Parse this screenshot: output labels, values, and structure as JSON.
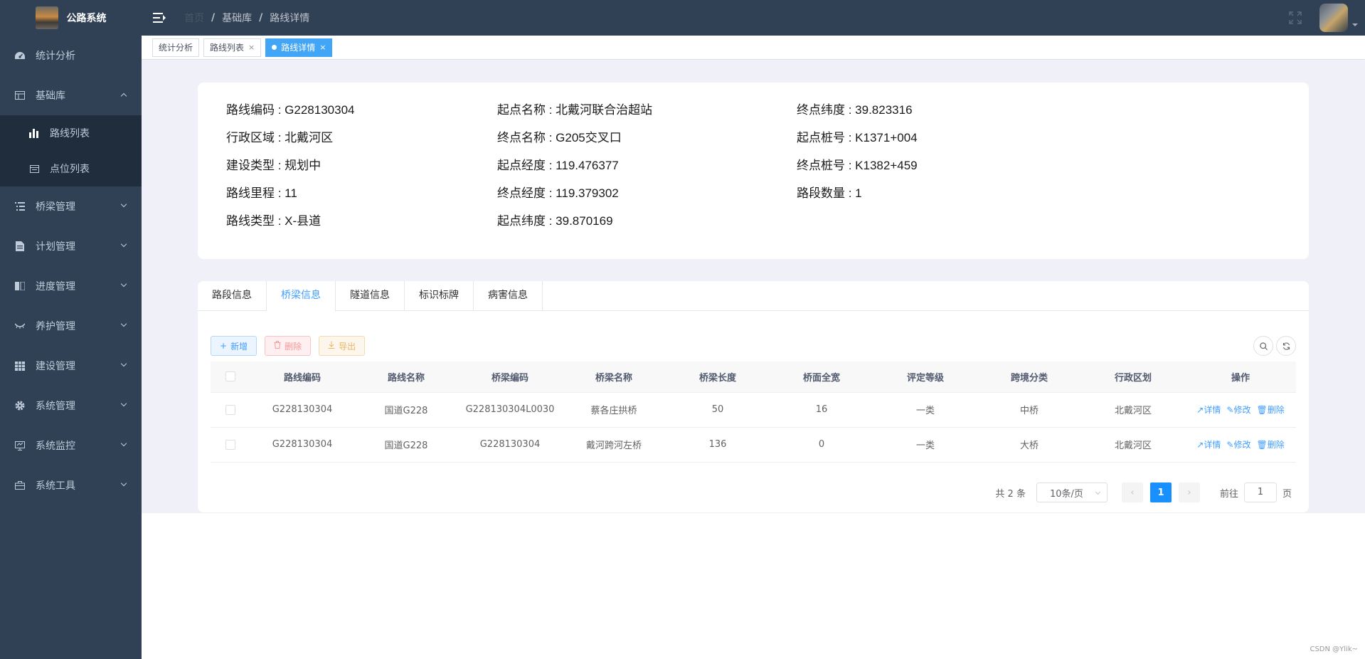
{
  "app": {
    "title": "公路系统"
  },
  "sidebar": {
    "items": [
      {
        "label": "统计分析",
        "icon": "dashboard-icon"
      },
      {
        "label": "基础库",
        "icon": "table-icon",
        "expanded": true,
        "children": [
          {
            "label": "路线列表",
            "icon": "chart-icon"
          },
          {
            "label": "点位列表",
            "icon": "calendar-icon"
          }
        ]
      },
      {
        "label": "桥梁管理",
        "icon": "list-icon"
      },
      {
        "label": "计划管理",
        "icon": "document-icon"
      },
      {
        "label": "进度管理",
        "icon": "book-icon"
      },
      {
        "label": "养护管理",
        "icon": "eye-icon"
      },
      {
        "label": "建设管理",
        "icon": "grid-icon"
      },
      {
        "label": "系统管理",
        "icon": "gear-icon"
      },
      {
        "label": "系统监控",
        "icon": "monitor-icon"
      },
      {
        "label": "系统工具",
        "icon": "toolbox-icon"
      }
    ]
  },
  "breadcrumb": {
    "home": "首页",
    "level1": "基础库",
    "level2": "路线详情"
  },
  "tags": [
    {
      "label": "统计分析"
    },
    {
      "label": "路线列表"
    },
    {
      "label": "路线详情",
      "active": true
    }
  ],
  "info": {
    "col1": [
      "路线编码 : G228130304",
      "行政区域 : 北戴河区",
      "建设类型 : 规划中",
      "路线里程 : 11",
      "路线类型 : X-县道"
    ],
    "col2": [
      "起点名称 : 北戴河联合治超站",
      "终点名称 : G205交叉口",
      "起点经度 : 119.476377",
      "终点经度 : 119.379302",
      "起点纬度 : 39.870169"
    ],
    "col3": [
      "终点纬度 : 39.823316",
      "起点桩号 : K1371+004",
      "终点桩号 : K1382+459",
      "路段数量 : 1"
    ]
  },
  "tabs": [
    "路段信息",
    "桥梁信息",
    "隧道信息",
    "标识标牌",
    "病害信息"
  ],
  "active_tab": "桥梁信息",
  "toolbar": {
    "add": "新增",
    "delete": "删除",
    "export": "导出"
  },
  "table": {
    "headers": [
      "路线编码",
      "路线名称",
      "桥梁编码",
      "桥梁名称",
      "桥梁长度",
      "桥面全宽",
      "评定等级",
      "跨境分类",
      "行政区划",
      "操作"
    ],
    "rows": [
      [
        "G228130304",
        "国道G228",
        "G228130304L0030",
        "蔡各庄拱桥",
        "50",
        "16",
        "一类",
        "中桥",
        "北戴河区"
      ],
      [
        "G228130304",
        "国道G228",
        "G228130304",
        "戴河跨河左桥",
        "136",
        "0",
        "一类",
        "大桥",
        "北戴河区"
      ]
    ],
    "actions": {
      "detail": "详情",
      "edit": "修改",
      "delete": "删除"
    }
  },
  "pager": {
    "total": "共 2 条",
    "page_size": "10条/页",
    "current": "1",
    "goto_prefix": "前往",
    "goto_value": "1",
    "goto_suffix": "页"
  },
  "watermark": "CSDN @Ylik~",
  "colors": {
    "sidebar": "#304156",
    "submenu": "#1f2d3d",
    "primary": "#409eff",
    "active_tag": "#42a5f5",
    "page_bg": "#eff0f8"
  }
}
